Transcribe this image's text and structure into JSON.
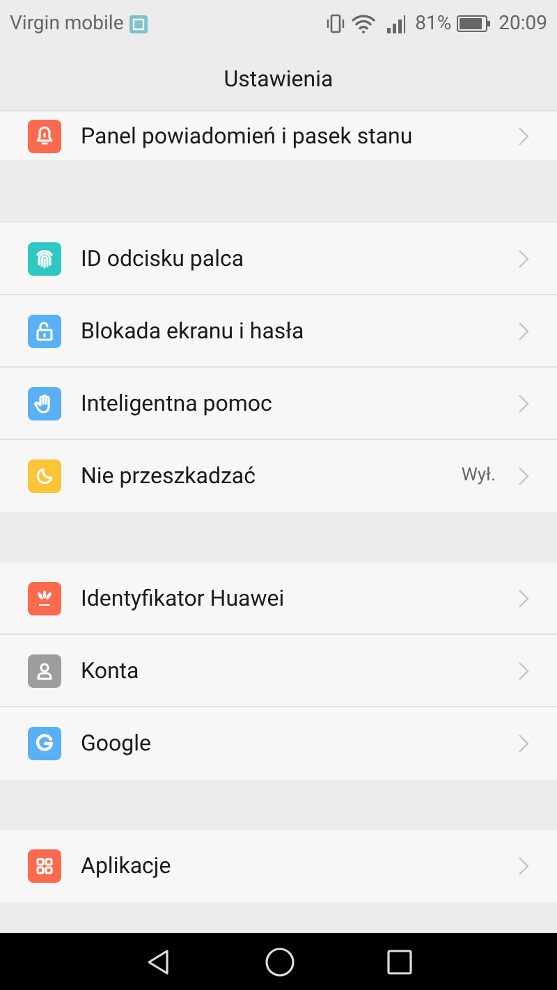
{
  "status_bar": {
    "carrier": "Virgin mobile",
    "battery_percent": "81%",
    "time": "20:09"
  },
  "header": {
    "title": "Ustawienia"
  },
  "groups": [
    {
      "items": [
        {
          "label": "Panel powiadomień i pasek stanu",
          "color": "#fb6a4f"
        }
      ]
    },
    {
      "items": [
        {
          "label": "ID odcisku palca",
          "color": "#2ec8c2"
        },
        {
          "label": "Blokada ekranu i hasła",
          "color": "#5ab0f5"
        },
        {
          "label": "Inteligentna pomoc",
          "color": "#5ab0f5"
        },
        {
          "label": "Nie przeszkadzać",
          "color": "#fcc437",
          "value": "Wył."
        }
      ]
    },
    {
      "items": [
        {
          "label": "Identyfikator Huawei",
          "color": "#fb6a4f"
        },
        {
          "label": "Konta",
          "color": "#9e9e9e"
        },
        {
          "label": "Google",
          "color": "#5ab0f5"
        }
      ]
    },
    {
      "items": [
        {
          "label": "Aplikacje",
          "color": "#fb6a4f"
        }
      ]
    }
  ]
}
